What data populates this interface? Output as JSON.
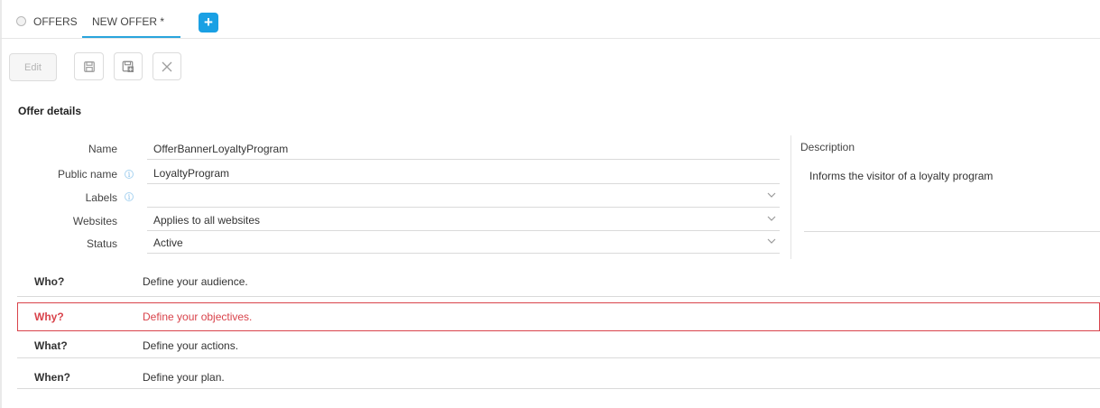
{
  "tabs": {
    "offers_label": "OFFERS",
    "new_offer_label": "NEW OFFER *",
    "add_label": "+"
  },
  "toolbar": {
    "edit_label": "Edit",
    "save_icon": "save-icon",
    "save_as_icon": "save-as-icon",
    "close_icon": "close-icon"
  },
  "section": {
    "title": "Offer details"
  },
  "form": {
    "name_label": "Name",
    "name_value": "OfferBannerLoyaltyProgram",
    "public_name_label": "Public name",
    "public_name_value": "LoyaltyProgram",
    "labels_label": "Labels",
    "labels_value": "",
    "websites_label": "Websites",
    "websites_value": "Applies to all websites",
    "status_label": "Status",
    "status_value": "Active",
    "info_glyph": "i"
  },
  "description": {
    "label": "Description",
    "value": "Informs the visitor of a loyalty program"
  },
  "steps": [
    {
      "key": "Who?",
      "text": "Define your audience."
    },
    {
      "key": "Why?",
      "text": "Define your objectives."
    },
    {
      "key": "What?",
      "text": "Define your actions."
    },
    {
      "key": "When?",
      "text": "Define your plan."
    }
  ],
  "colors": {
    "accent": "#1aa0e4",
    "tab_underline": "#2aa5dc",
    "error": "#d9434b"
  }
}
